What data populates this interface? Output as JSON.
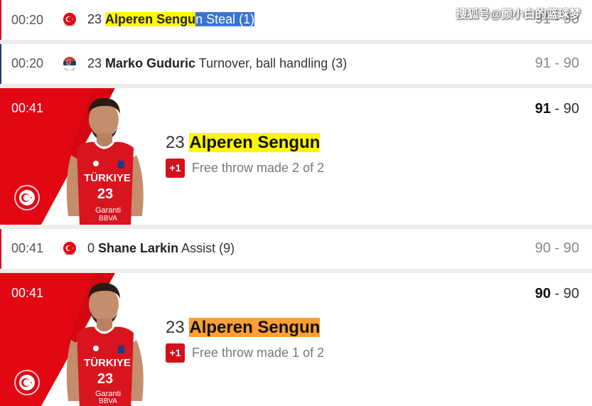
{
  "watermark": "搜狐号@颜小白的篮球梦",
  "colors": {
    "accent_red": "#e30613",
    "highlight_yellow": "#fdf800",
    "highlight_orange": "#ff9f35",
    "highlight_blue": "#3a74d0"
  },
  "events": [
    {
      "time": "00:20",
      "flag_icon": "turkey-flag-icon",
      "number": "23",
      "player_part1": "Alperen Sengu",
      "player_part2": "n",
      "action": " Steal (1)",
      "score": "91 - 90"
    },
    {
      "time": "00:20",
      "flag_icon": "serbia-flag-icon",
      "number": "23",
      "player": "Marko Guduric",
      "action": "Turnover, ball handling (3)",
      "score": "91 - 90"
    },
    {
      "time": "00:41",
      "number": "23",
      "player": "Alperen Sengun",
      "badge": "+1",
      "action": "Free throw made 2 of 2",
      "score_home": "91",
      "score_sep": " - ",
      "score_away": "90",
      "jersey_country": "TÜRKIYE",
      "jersey_number": "23",
      "jersey_sponsor1": "Garanti",
      "jersey_sponsor2": "BBVA"
    },
    {
      "time": "00:41",
      "flag_icon": "turkey-flag-icon",
      "number": "0",
      "player": "Shane Larkin",
      "action": "Assist (9)",
      "score": "90 - 90"
    },
    {
      "time": "00:41",
      "number": "23",
      "player": "Alperen Sengun",
      "badge": "+1",
      "action": "Free throw made 1 of 2",
      "score_home": "90",
      "score_sep": " - ",
      "score_away": "90",
      "jersey_country": "TÜRKIYE",
      "jersey_number": "23",
      "jersey_sponsor1": "Garanti",
      "jersey_sponsor2": "BBVA"
    }
  ]
}
